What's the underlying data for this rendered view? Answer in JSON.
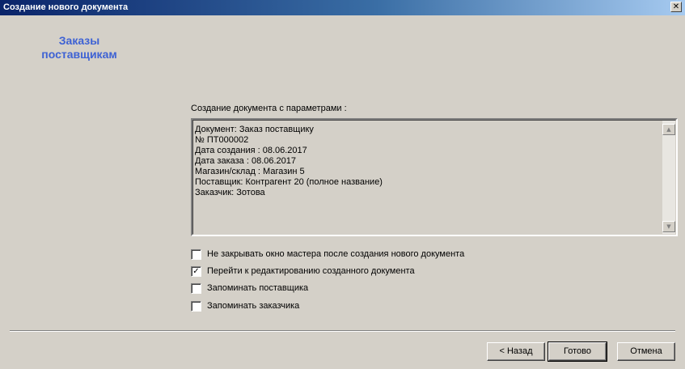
{
  "window": {
    "title": "Создание нового документа",
    "close_glyph": "✕"
  },
  "sidebar": {
    "title_line1": "Заказы",
    "title_line2": "поставщикам"
  },
  "params": {
    "label": "Создание документа с параметрами :",
    "lines": [
      "Документ: Заказ поставщику",
      "№ ПТ000002",
      "Дата создания : 08.06.2017",
      "Дата заказа : 08.06.2017",
      "Магазин/склад : Магазин 5",
      "Поставщик: Контрагент 20 (полное название)",
      "Заказчик: Зотова"
    ]
  },
  "options": [
    {
      "label": "Не закрывать окно мастера после создания нового документа",
      "checked": false
    },
    {
      "label": "Перейти к редактированию созданного документа",
      "checked": true
    },
    {
      "label": "Запоминать поставщика",
      "checked": false
    },
    {
      "label": "Запоминать заказчика",
      "checked": false
    }
  ],
  "buttons": {
    "back": "< Назад",
    "finish": "Готово",
    "cancel": "Отмена"
  },
  "colors": {
    "title_gradient_start": "#0a246a",
    "side_title": "#3e62d4",
    "face": "#d4d0c8"
  }
}
